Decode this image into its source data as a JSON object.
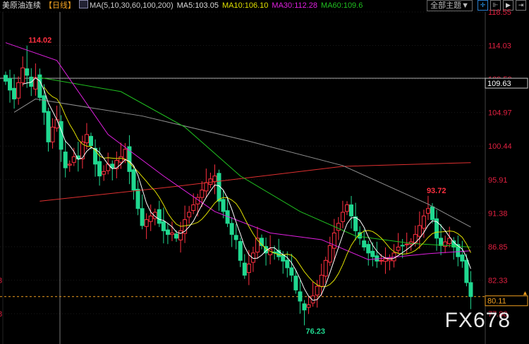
{
  "header": {
    "title": "美原油连续",
    "period": "【日线】",
    "ma_label": "MA(5,10,30,60,100,200)",
    "ma5": "MA5:103.05",
    "ma10": "MA10:106.10",
    "ma30": "MA30:112.28",
    "ma60": "MA60:109.6",
    "theme_button": "全部主题▼"
  },
  "icons": [
    "crosshair-icon",
    "zoom-in-icon",
    "zoom-out-icon",
    "move-end-icon"
  ],
  "watermark": "FX678",
  "colors": {
    "up": "#ff3040",
    "down": "#20d890",
    "ma5": "#ffffff",
    "ma10": "#e0e000",
    "ma30": "#e020e0",
    "ma60": "#20c020",
    "ma100": "#909090",
    "ma200": "#e03030",
    "axis_text": "#e02040",
    "current": "#f0a020"
  },
  "chart_data": {
    "type": "candlestick",
    "title": "美原油连续 日线",
    "y_ticks": [
      "118.55",
      "114.03",
      "109.50",
      "104.97",
      "100.44",
      "95.91",
      "91.38",
      "86.85",
      "82.33",
      "77.80"
    ],
    "ylim": [
      77.8,
      118.55
    ],
    "crosshair_value": "109.63",
    "current_price": "80.11",
    "annotations": {
      "high": "114.02",
      "high2": "93.72",
      "low": "76.23"
    },
    "closes": [
      109.2,
      108,
      106.8,
      109,
      111,
      110,
      108.5,
      109.7,
      107,
      105,
      101,
      103,
      104,
      100,
      97.5,
      98,
      99,
      98.7,
      101,
      102,
      100.5,
      98,
      96.4,
      97,
      98,
      97.5,
      98.5,
      99,
      100,
      97,
      94.5,
      92,
      89.7,
      90.5,
      91,
      91.5,
      90,
      89,
      88.5,
      88.7,
      88,
      89,
      90.5,
      91.5,
      92.5,
      93.5,
      94.5,
      95.5,
      96,
      96.4,
      93,
      91.6,
      90,
      88.5,
      87.8,
      85,
      83,
      84.5,
      86,
      88,
      87,
      86,
      86.5,
      86,
      85.5,
      84.9,
      84,
      83,
      81,
      79.5,
      78.3,
      79,
      80.2,
      81.5,
      83,
      85,
      87,
      88.7,
      90,
      91.5,
      92.5,
      91,
      89,
      88,
      86.8,
      86,
      85.5,
      84.9,
      85,
      85.2,
      85.3,
      86,
      86.8,
      87,
      87.2,
      87.5,
      88.5,
      89.7,
      91,
      92,
      90.5,
      88,
      87,
      87.5,
      88,
      86.8,
      85.5,
      84.9,
      82,
      80.11
    ],
    "ma_lines": {
      "MA30": [
        [
          0,
          114.4
        ],
        [
          12,
          112
        ],
        [
          24,
          102
        ],
        [
          37,
          96.4
        ],
        [
          49,
          91.6
        ],
        [
          62,
          88.7
        ],
        [
          74,
          87.8
        ],
        [
          85,
          85.1
        ],
        [
          99,
          85.9
        ],
        [
          109,
          86.3
        ]
      ],
      "MA60": [
        [
          8,
          109.7
        ],
        [
          27,
          107.8
        ],
        [
          42,
          103
        ],
        [
          55,
          96.4
        ],
        [
          69,
          91.6
        ],
        [
          82,
          88.3
        ],
        [
          95,
          87.3
        ],
        [
          109,
          86.8
        ]
      ],
      "MA100": [
        [
          2,
          105
        ],
        [
          7,
          106.8
        ],
        [
          32,
          104.5
        ],
        [
          57,
          101.1
        ],
        [
          79,
          97.8
        ],
        [
          99,
          92.6
        ],
        [
          109,
          89.5
        ]
      ],
      "MA200": [
        [
          8,
          93
        ],
        [
          40,
          95
        ],
        [
          79,
          97.7
        ],
        [
          109,
          98.2
        ]
      ]
    }
  }
}
